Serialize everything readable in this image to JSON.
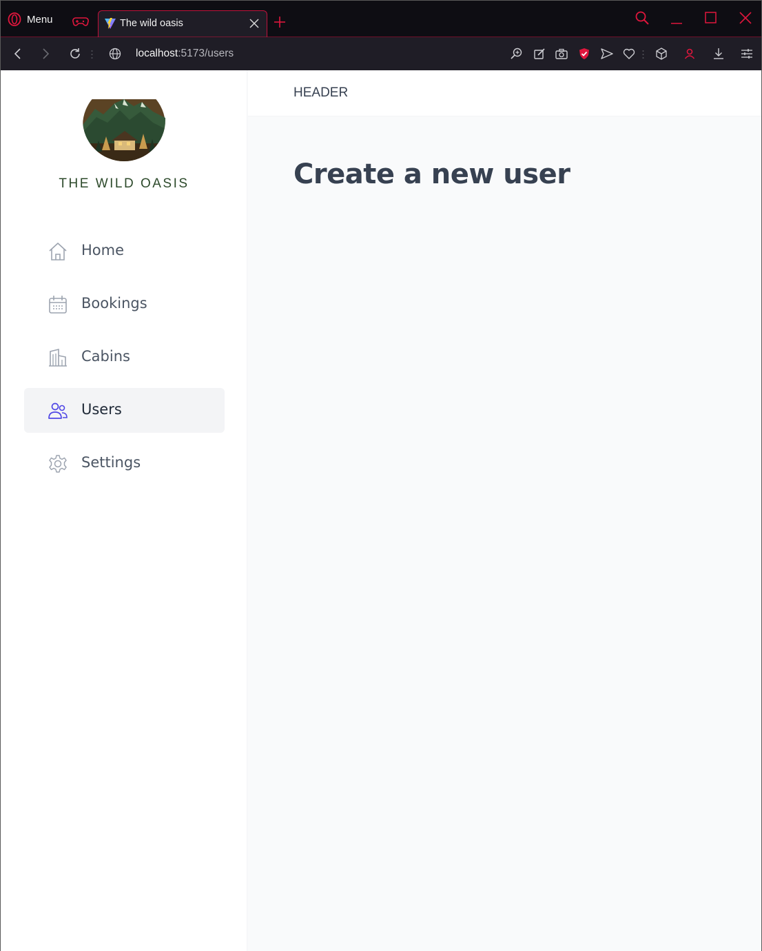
{
  "browser": {
    "menu_label": "Menu",
    "tab": {
      "title": "The wild oasis"
    },
    "url": {
      "host": "localhost",
      "path": ":5173/users"
    },
    "accent_color": "#e0163d"
  },
  "sidebar": {
    "logo_alt": "The Wild Oasis logo",
    "brand": "THE WILD OASIS",
    "items": [
      {
        "label": "Home",
        "icon": "home-icon",
        "active": false
      },
      {
        "label": "Bookings",
        "icon": "calendar-icon",
        "active": false
      },
      {
        "label": "Cabins",
        "icon": "buildings-icon",
        "active": false
      },
      {
        "label": "Users",
        "icon": "users-icon",
        "active": true
      },
      {
        "label": "Settings",
        "icon": "gear-icon",
        "active": false
      }
    ],
    "active_color": "#4f46e5"
  },
  "header": {
    "text": "HEADER"
  },
  "main": {
    "title": "Create a new user"
  }
}
